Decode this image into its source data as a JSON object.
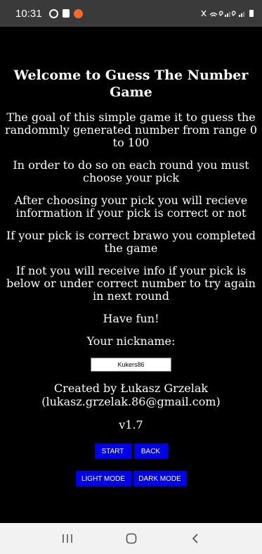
{
  "status_bar": {
    "time": "10:31",
    "left_icons": [
      "sync-icon",
      "cast-icon",
      "app-notification-icon"
    ],
    "right_text": "✕ᯤ ᯤ ᯤ"
  },
  "app": {
    "title": "Welcome to Guess The Number Game",
    "paragraphs": [
      "The goal of this simple game it to guess the randommly generated number from range 0 to 100",
      "In order to do so on each round you must choose your pick",
      "After choosing your pick you will recieve information if your pick is correct or not",
      "If your pick is correct brawo you completed the game",
      "If not you will receive info if your pick is below or under correct number to try again in next round",
      "Have fun!"
    ],
    "nickname_label": "Your nickname:",
    "nickname_value": "Kukers86",
    "credits_name": "Created by Łukasz Grzelak",
    "credits_email": "(lukasz.grzelak.86@gmail.com)",
    "version": "v1.7",
    "buttons": {
      "start": "START",
      "back": "BACK",
      "light_mode": "LIGHT MODE",
      "dark_mode": "DARK MODE"
    },
    "button_color": "#0000e6",
    "background_color": "#000000"
  },
  "nav_bar": {
    "icons": [
      "recent-apps-icon",
      "home-icon",
      "back-icon"
    ]
  }
}
